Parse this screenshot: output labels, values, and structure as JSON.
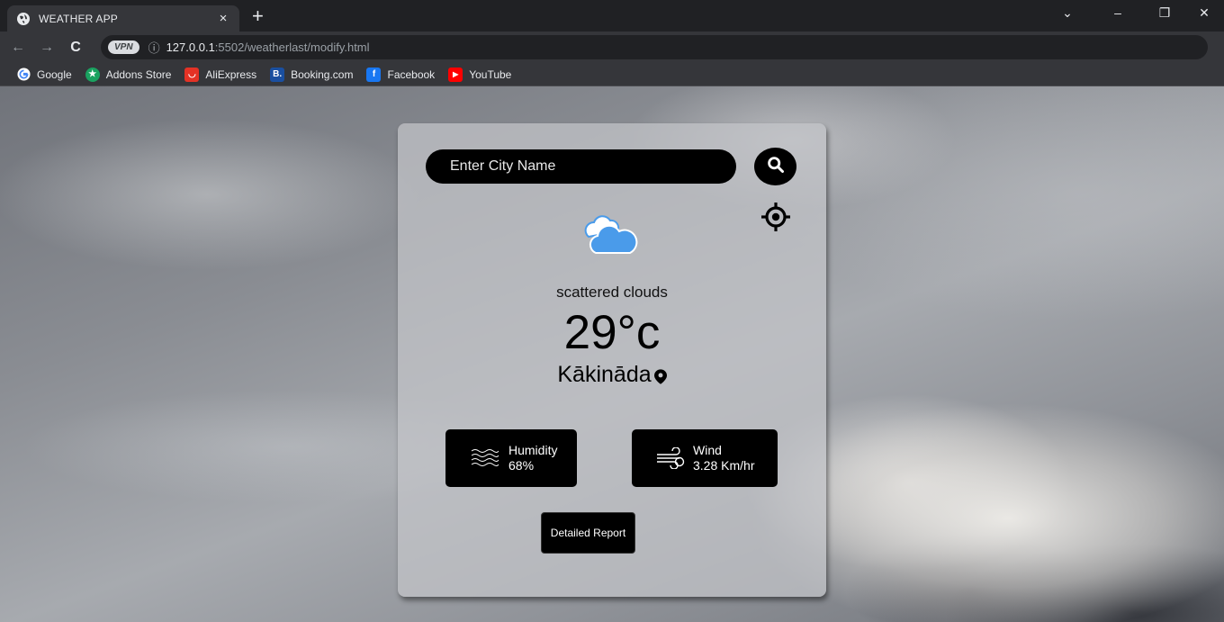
{
  "browser": {
    "tab_title": "WEATHER APP",
    "tab_close": "×",
    "new_tab": "+",
    "window_controls": {
      "collapse": "⌄",
      "minimize": "–",
      "restore": "❐",
      "close": "✕"
    },
    "nav": {
      "back": "←",
      "forward": "→",
      "reload": "C"
    },
    "vpn_label": "VPN",
    "url_host": "127.0.0.1",
    "url_path": ":5502/weatherlast/modify.html",
    "bookmarks": [
      {
        "label": "Google",
        "icon": "google-icon",
        "color": "#ffffff",
        "glyph": "G"
      },
      {
        "label": "Addons Store",
        "icon": "addons-store-icon",
        "color": "#1aa260",
        "glyph": "★"
      },
      {
        "label": "AliExpress",
        "icon": "aliexpress-icon",
        "color": "#e43225",
        "glyph": "◡"
      },
      {
        "label": "Booking.com",
        "icon": "booking-icon",
        "color": "#1a4fa0",
        "glyph": "B."
      },
      {
        "label": "Facebook",
        "icon": "facebook-icon",
        "color": "#1877f2",
        "glyph": "f"
      },
      {
        "label": "YouTube",
        "icon": "youtube-icon",
        "color": "#ff0000",
        "glyph": "▶"
      }
    ]
  },
  "app": {
    "search_placeholder": "Enter City Name",
    "description": "scattered clouds",
    "temperature": "29°c",
    "city": "Kākināda",
    "humidity_label": "Humidity",
    "humidity_value": "68%",
    "wind_label": "Wind",
    "wind_value": "3.28 Km/hr",
    "report_button": "Detailed Report"
  },
  "colors": {
    "card_bg": "rgba(196,197,201,0.72)",
    "button_bg": "#000000",
    "cloud_blue": "#4a9bea"
  }
}
